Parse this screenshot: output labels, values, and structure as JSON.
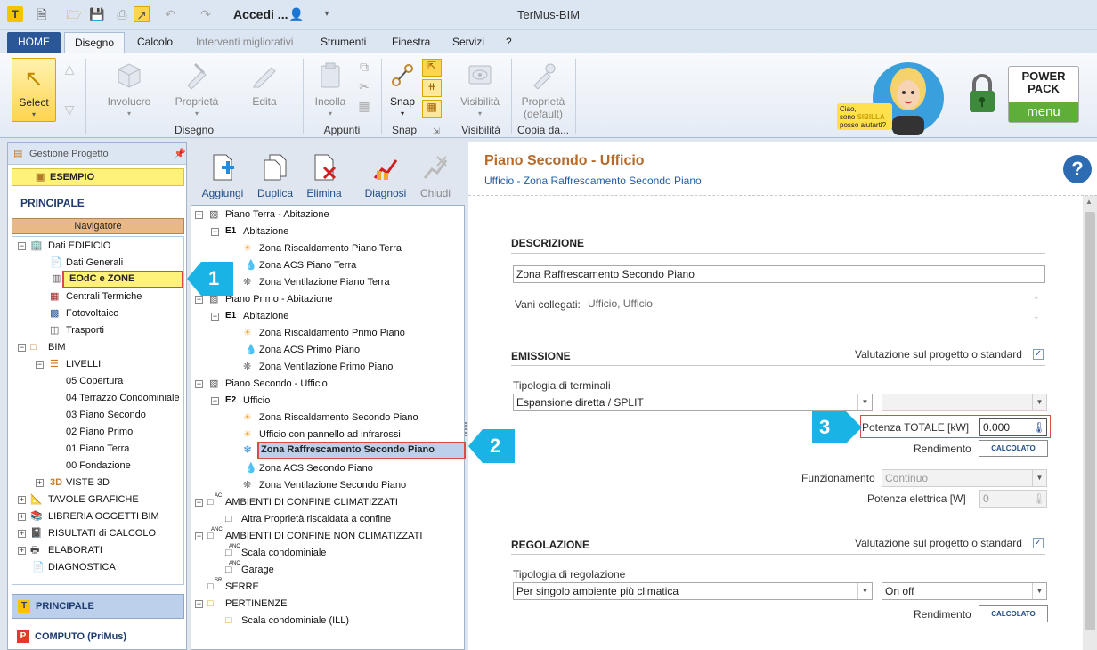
{
  "window": {
    "title": "TerMus-BIM",
    "document": "Accedi ..."
  },
  "tabs": {
    "home": "HOME",
    "disegno": "Disegno",
    "calcolo": "Calcolo",
    "interventi": "Interventi migliorativi",
    "strumenti": "Strumenti",
    "finestra": "Finestra",
    "servizi": "Servizi",
    "help": "?"
  },
  "ribbon": {
    "select": "Select",
    "involucro": "Involucro",
    "proprieta": "Proprietà",
    "edita": "Edita",
    "incolla": "Incolla",
    "snap": "Snap",
    "visibilita": "Visibilità",
    "proprieta_default_1": "Proprietà",
    "proprieta_default_2": "(default)",
    "groups": {
      "disegno": "Disegno",
      "appunti": "Appunti",
      "snap": "Snap",
      "visibilita": "Visibilità",
      "copia": "Copia da..."
    }
  },
  "sibilla": {
    "line1": "Ciao,",
    "line2": "sono",
    "name": "SIBILLA",
    "line3": "posso aiutarti?"
  },
  "powerpack": {
    "line1": "POWER",
    "line2": "PACK",
    "line3": "menu"
  },
  "left": {
    "header": "Gestione Progetto",
    "esempio": "ESEMPIO",
    "principale": "PRINCIPALE",
    "navigatore": "Navigatore",
    "tree": [
      "Dati EDIFICIO",
      "Dati Generali",
      "EOdC e ZONE",
      "Centrali Termiche",
      "Fotovoltaico",
      "Trasporti",
      "BIM",
      "LIVELLI",
      "05 Copertura",
      "04 Terrazzo Condominiale",
      "03 Piano Secondo",
      "02 Piano Primo",
      "01 Piano Terra",
      "00 Fondazione",
      "VISTE 3D",
      "TAVOLE GRAFICHE",
      "LIBRERIA OGGETTI BIM",
      "RISULTATI di CALCOLO",
      "ELABORATI",
      "DIAGNOSTICA"
    ],
    "bottom_principale": "PRINCIPALE",
    "bottom_computo": "COMPUTO (PriMus)"
  },
  "middle": {
    "toolbar": {
      "aggiungi": "Aggiungi",
      "duplica": "Duplica",
      "elimina": "Elimina",
      "diagnosi": "Diagnosi",
      "chiudi": "Chiudi"
    },
    "tree": [
      "Piano Terra - Abitazione",
      "Abitazione",
      "Zona Riscaldamento Piano Terra",
      "Zona ACS Piano Terra",
      "Zona Ventilazione Piano Terra",
      "Piano Primo - Abitazione",
      "Abitazione",
      "Zona Riscaldamento Primo Piano",
      "Zona ACS Primo Piano",
      "Zona Ventilazione Primo Piano",
      "Piano Secondo - Ufficio",
      "Ufficio",
      "Zona Riscaldamento Secondo Piano",
      "Ufficio con pannello ad infrarossi",
      "Zona Raffrescamento Secondo Piano",
      "Zona ACS Secondo Piano",
      "Zona Ventilazione Secondo Piano",
      "AMBIENTI DI CONFINE CLIMATIZZATI",
      "Altra Proprietà riscaldata a confine",
      "AMBIENTI DI CONFINE NON CLIMATIZZATI",
      "Scala condominiale",
      "Garage",
      "SERRE",
      "PERTINENZE",
      "Scala condominiale (ILL)"
    ],
    "tags": {
      "e1": "E1",
      "e1b": "E1",
      "e2": "E2",
      "ac": "AC",
      "anc": "ANC",
      "anc2": "ANC",
      "anc3": "ANC",
      "sr": "SR"
    }
  },
  "right": {
    "title": "Piano Secondo - Ufficio",
    "subtitle": "Ufficio - Zona Raffrescamento Secondo Piano",
    "descrizione": {
      "title": "DESCRIZIONE",
      "value": "Zona Raffrescamento Secondo Piano",
      "vani_label": "Vani collegati:",
      "vani_value": "Ufficio, Ufficio"
    },
    "emissione": {
      "title": "EMISSIONE",
      "valutazione": "Valutazione sul progetto o standard",
      "tipologia_label": "Tipologia di terminali",
      "tipologia_value": "Espansione diretta / SPLIT",
      "potenza_label": "Potenza TOTALE [kW]",
      "potenza_value": "0.000",
      "rendimento_label": "Rendimento",
      "calcolato": "CALCOLATO",
      "funzionamento_label": "Funzionamento",
      "funzionamento_value": "Continuo",
      "potenza_el_label": "Potenza elettrica [W]",
      "potenza_el_value": "0"
    },
    "regolazione": {
      "title": "REGOLAZIONE",
      "valutazione": "Valutazione sul progetto o standard",
      "tipologia_label": "Tipologia di regolazione",
      "tipologia_value": "Per singolo ambiente più climatica",
      "modo_value": "On off",
      "rendimento_label": "Rendimento",
      "calcolato": "CALCOLATO"
    }
  },
  "callouts": {
    "one": "1",
    "two": "2",
    "three": "3"
  },
  "colors": {
    "accent_blue": "#2b5797",
    "highlight_yellow": "#fff27a",
    "callout_cyan": "#19b3e6",
    "title_orange": "#b86a2a",
    "red_frame": "#d94a4a"
  }
}
